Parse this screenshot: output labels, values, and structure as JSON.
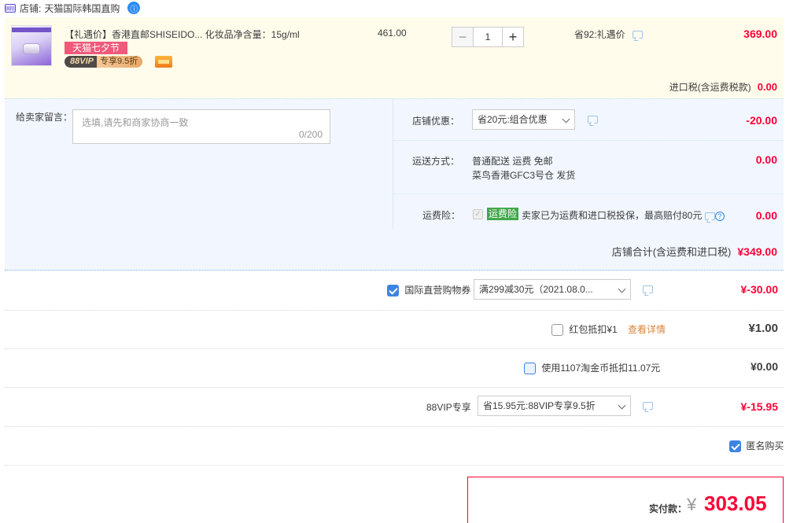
{
  "shop": {
    "label": "店铺:",
    "name": "天猫国际韩国直购",
    "icon_text": "国际",
    "ww_icon": "ⓘ"
  },
  "item": {
    "title": "【礼遇价】香港直邮SHISEIDO... 化妆品净含量：15g/ml",
    "tag_qixi": "天猫七夕节",
    "vip_left": "88VIP",
    "vip_right": "专享9.5折",
    "unit_price": "461.00",
    "qty_minus": "−",
    "qty_value": "1",
    "qty_plus": "+",
    "save_text": "省92:礼遇价",
    "total": "369.00",
    "tax_label": "进口税(含运费税款)",
    "tax_value": "0.00"
  },
  "message": {
    "label": "给卖家留言：",
    "placeholder": "选填,请先和商家协商一致",
    "count": "0/200"
  },
  "store_discount": {
    "label": "店铺优惠：",
    "select": "省20元:组合优惠",
    "value": "-20.00"
  },
  "shipping": {
    "label": "运送方式：",
    "line1": "普通配送 运费 免邮",
    "line2": "菜鸟香港GFC3号仓   发货",
    "value": "0.00"
  },
  "insurance": {
    "label": "运费险：",
    "tag": "运费险",
    "text": "卖家已为运费和进口税投保，最高赔付80元",
    "value": "0.00",
    "help": "?"
  },
  "shop_total": {
    "label": "店铺合计(含运费和进口税)",
    "value": "¥349.00"
  },
  "coupon": {
    "label": "国际直营购物券",
    "select": "满299减30元（2021.08.0...",
    "value": "¥-30.00"
  },
  "redpacket": {
    "label": "红包抵扣¥1",
    "link": "查看详情",
    "value": "¥1.00"
  },
  "taojinbi": {
    "label": "使用1107淘金币抵扣11.07元",
    "value": "¥0.00"
  },
  "vip88": {
    "label": "88VIP专享",
    "select": "省15.95元:88VIP专享9.5折",
    "value": "¥-15.95"
  },
  "anonymous": {
    "label": "匿名购买"
  },
  "payment": {
    "label": "实付款：",
    "currency": "¥",
    "amount": "303.05"
  },
  "colors": {
    "accent_red": "#ff0036",
    "blue_check": "#3d83e3",
    "item_bg": "#fffceb",
    "shop_bg": "#f2f7ff"
  }
}
